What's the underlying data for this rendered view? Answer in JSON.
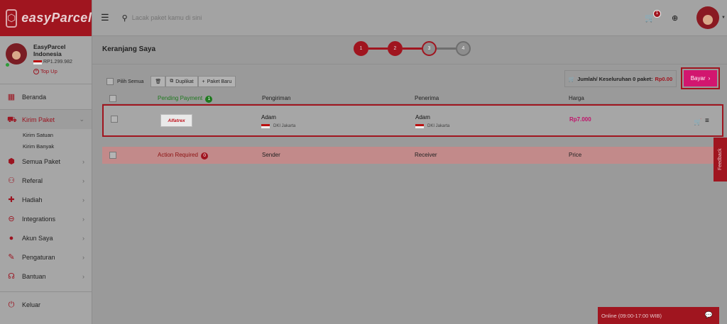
{
  "brand": {
    "logo_text": "easyParcel"
  },
  "colors": {
    "brand_red": "#a0151f",
    "pay_pink": "#d2166f",
    "pending_green": "#1f7a1f",
    "price_pink": "#c0136a"
  },
  "header": {
    "search": {
      "placeholder": "Lacak paket kamu di sini"
    },
    "cart_badge": "1",
    "icons": [
      "hamburger-icon",
      "search-icon",
      "cart-icon",
      "globe-icon",
      "avatar"
    ]
  },
  "profile": {
    "name_line1": "EasyParcel",
    "name_line2": "Indonesia",
    "balance": "RP1.299.982",
    "topup_label": "Top Up"
  },
  "sidebar": {
    "items": [
      {
        "label": "Beranda",
        "icon": "dashboard-icon",
        "glyph": "▦"
      },
      {
        "label": "Kirim Paket",
        "icon": "truck-icon",
        "glyph": "⛟"
      },
      {
        "label": "Semua Paket",
        "icon": "packages-icon",
        "glyph": "⬢"
      },
      {
        "label": "Referal",
        "icon": "referral-icon",
        "glyph": "⚇"
      },
      {
        "label": "Hadiah",
        "icon": "gift-icon",
        "glyph": "🎁"
      },
      {
        "label": "Integrations",
        "icon": "link-icon",
        "glyph": "⊖"
      },
      {
        "label": "Akun Saya",
        "icon": "user-icon",
        "glyph": "●"
      },
      {
        "label": "Pengaturan",
        "icon": "wrench-icon",
        "glyph": "🔧"
      },
      {
        "label": "Bantuan",
        "icon": "headset-icon",
        "glyph": "☊"
      }
    ],
    "submenu": [
      "Kirim Satuan",
      "Kirim Banyak"
    ],
    "logout_label": "Keluar"
  },
  "main": {
    "title": "Keranjang Saya",
    "steps": [
      "1",
      "2",
      "3",
      "4"
    ],
    "toolbar": {
      "select_all": "Pilih Semua",
      "duplicate": "Duplikat",
      "new_package": "Paket Baru"
    },
    "total_label": "Jumlah/ Keseluruhan 0 paket:",
    "total_amount": "Rp0.00",
    "pay_label": "Bayar",
    "table": {
      "pending_label": "Pending Payment",
      "pending_count": "1",
      "col_sender": "Pengiriman",
      "col_receiver": "Penerima",
      "col_price": "Harga"
    },
    "order": {
      "courier": "Alfatrex",
      "sender_name": "Adam",
      "sender_loc": "DKI Jakarta",
      "receiver_name": "Adam",
      "receiver_loc": "DKI Jakarta",
      "price": "Rp7.000"
    },
    "action": {
      "label": "Action Required",
      "count": "0",
      "col_sender": "Sender",
      "col_receiver": "Receiver",
      "col_price": "Price"
    }
  },
  "feedback_label": "Feedback",
  "chat_label": "Online (09:00-17:00 WIB)"
}
